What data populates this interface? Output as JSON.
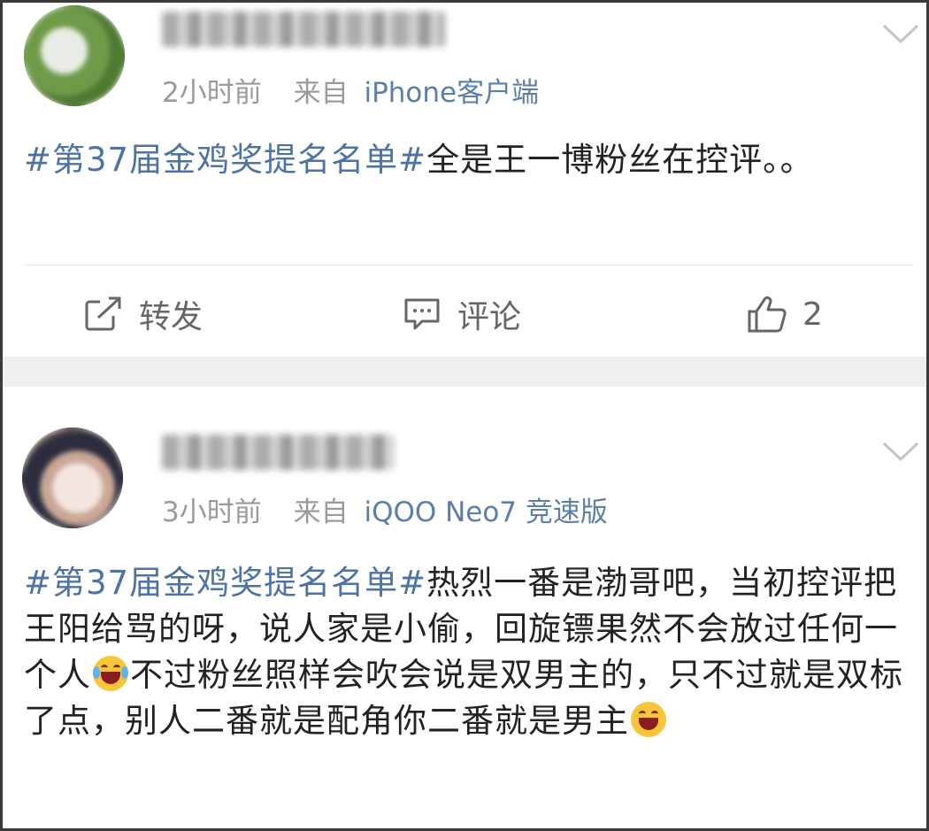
{
  "posts": [
    {
      "time": "2小时前",
      "source_prefix": "来自",
      "device": "iPhone客户端",
      "hashtag": "#第37届金鸡奖提名名单#",
      "body": "全是王一博粉丝在控评。。",
      "actions": {
        "repost": "转发",
        "comment": "评论",
        "like_count": "2"
      }
    },
    {
      "time": "3小时前",
      "source_prefix": "来自",
      "device": "iQOO Neo7 竞速版",
      "hashtag": "#第37届金鸡奖提名名单#",
      "body_part1": "热烈一番是渤哥吧，当初控评把王阳给骂的呀，说人家是小偷，回旋镖果然不会放过任何一个人",
      "body_part2": "不过粉丝照样会吹会说是双男主的，只不过就是双标了点，别人二番就是配角你二番就是男主"
    }
  ],
  "icons": {
    "chevron": "chevron-down-icon",
    "repost": "repost-icon",
    "comment": "comment-icon",
    "like": "thumbs-up-icon",
    "emoji1": "laughing-tears-emoji",
    "emoji2": "grinning-emoji"
  },
  "colors": {
    "link": "#4c72a6",
    "device": "#5b7fa6",
    "meta": "#9a9a9a",
    "band": "#efefef"
  }
}
